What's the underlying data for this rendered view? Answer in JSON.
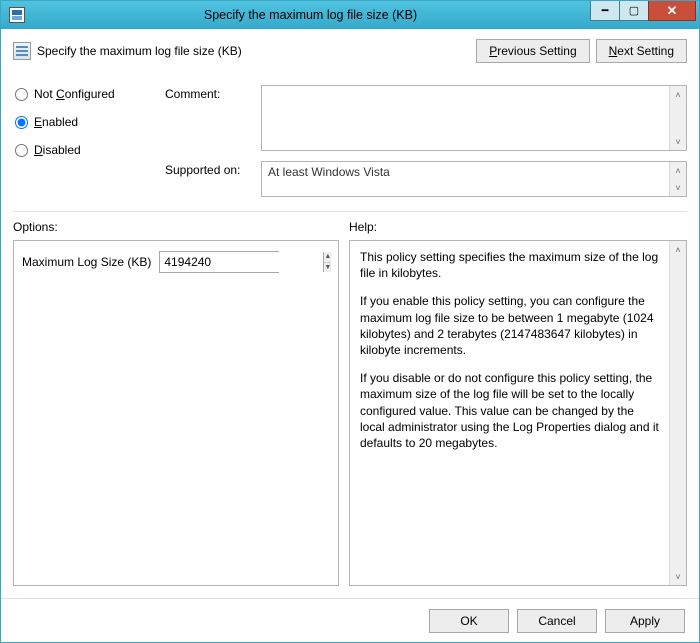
{
  "window": {
    "title": "Specify the maximum log file size (KB)",
    "min_tip": "Minimize",
    "max_tip": "Maximize",
    "close_tip": "Close"
  },
  "header": {
    "heading": "Specify the maximum log file size (KB)",
    "prev": "Previous Setting",
    "next": "Next Setting"
  },
  "state": {
    "not_configured": "Not Configured",
    "enabled": "Enabled",
    "disabled": "Disabled",
    "selected": "enabled",
    "comment_label": "Comment:",
    "comment_value": "",
    "supported_label": "Supported on:",
    "supported_value": "At least Windows Vista"
  },
  "sections": {
    "options": "Options:",
    "help": "Help:"
  },
  "options": {
    "label": "Maximum Log Size (KB)",
    "value": "4194240"
  },
  "help": {
    "p1": "This policy setting specifies the maximum size of the log file in kilobytes.",
    "p2": "If you enable this policy setting, you can configure the maximum log file size to be between 1 megabyte (1024 kilobytes) and 2 terabytes (2147483647 kilobytes) in kilobyte increments.",
    "p3": "If you disable or do not configure this policy setting, the maximum size of the log file will be set to the locally configured value. This value can be changed by the local administrator using the Log Properties dialog and it defaults to 20 megabytes."
  },
  "footer": {
    "ok": "OK",
    "cancel": "Cancel",
    "apply": "Apply"
  }
}
